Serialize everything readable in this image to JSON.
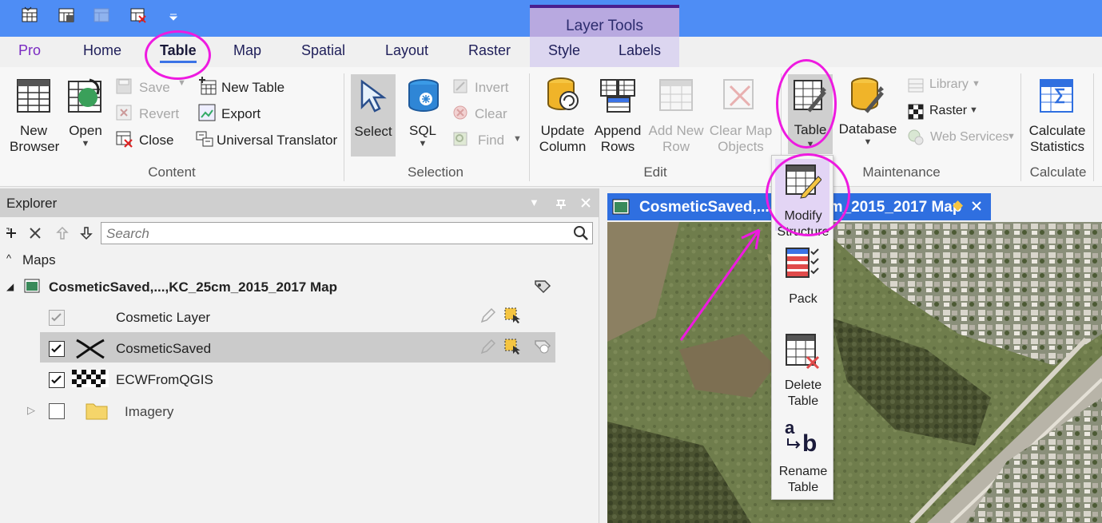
{
  "title_bar": {
    "context_header": "Layer Tools"
  },
  "tabs": [
    {
      "label": "Pro"
    },
    {
      "label": "Home"
    },
    {
      "label": "Table"
    },
    {
      "label": "Map"
    },
    {
      "label": "Spatial"
    },
    {
      "label": "Layout"
    },
    {
      "label": "Raster"
    },
    {
      "label": "Style"
    },
    {
      "label": "Labels"
    }
  ],
  "ribbon": {
    "content": {
      "group": "Content",
      "new_browser": [
        "New",
        "Browser"
      ],
      "open": "Open",
      "save": "Save",
      "revert": "Revert",
      "close": "Close",
      "new_table": "New Table",
      "export": "Export",
      "universal_translator": "Universal Translator"
    },
    "selection": {
      "group": "Selection",
      "select": "Select",
      "sql": "SQL",
      "invert": "Invert",
      "clear": "Clear",
      "find": "Find"
    },
    "edit": {
      "group": "Edit",
      "update_column": [
        "Update",
        "Column"
      ],
      "append_rows": [
        "Append",
        "Rows"
      ],
      "add_new_row": [
        "Add New",
        "Row"
      ],
      "clear_map_objects": [
        "Clear Map",
        "Objects"
      ]
    },
    "maintenance": {
      "group": "Maintenance",
      "table": "Table",
      "database": "Database",
      "library": "Library",
      "raster": "Raster",
      "web_services": "Web Services"
    },
    "calculate": {
      "group": "Calculate",
      "calculate_statistics": [
        "Calculate",
        "Statistics"
      ]
    }
  },
  "explorer": {
    "title": "Explorer",
    "search_placeholder": "Search",
    "maps_label": "Maps",
    "map_name": "CosmeticSaved,...,KC_25cm_2015_2017 Map",
    "layers": [
      {
        "name": "Cosmetic Layer",
        "checked": true,
        "enabled": false
      },
      {
        "name": "CosmeticSaved",
        "checked": true,
        "selected": true
      },
      {
        "name": "ECWFromQGIS",
        "checked": true
      },
      {
        "name": "Imagery",
        "checked": false
      }
    ]
  },
  "map_window": {
    "tab_title": "CosmeticSaved,...,KC_25cm_2015_2017 Map",
    "tab_title_hidden_part": "CosmeticSaved,...,K"
  },
  "table_dropdown": {
    "items": [
      {
        "label": [
          "Modify",
          "Structure"
        ]
      },
      {
        "label": [
          "Pack"
        ]
      },
      {
        "label": [
          "Delete",
          "Table"
        ]
      },
      {
        "label": [
          "Rename",
          "Table"
        ]
      }
    ]
  },
  "colors": {
    "title_bar": "#4e8df5",
    "annotation": "#ee1ae0",
    "context_tab": "#b8a9e0",
    "map_tab": "#2f6fe0"
  }
}
